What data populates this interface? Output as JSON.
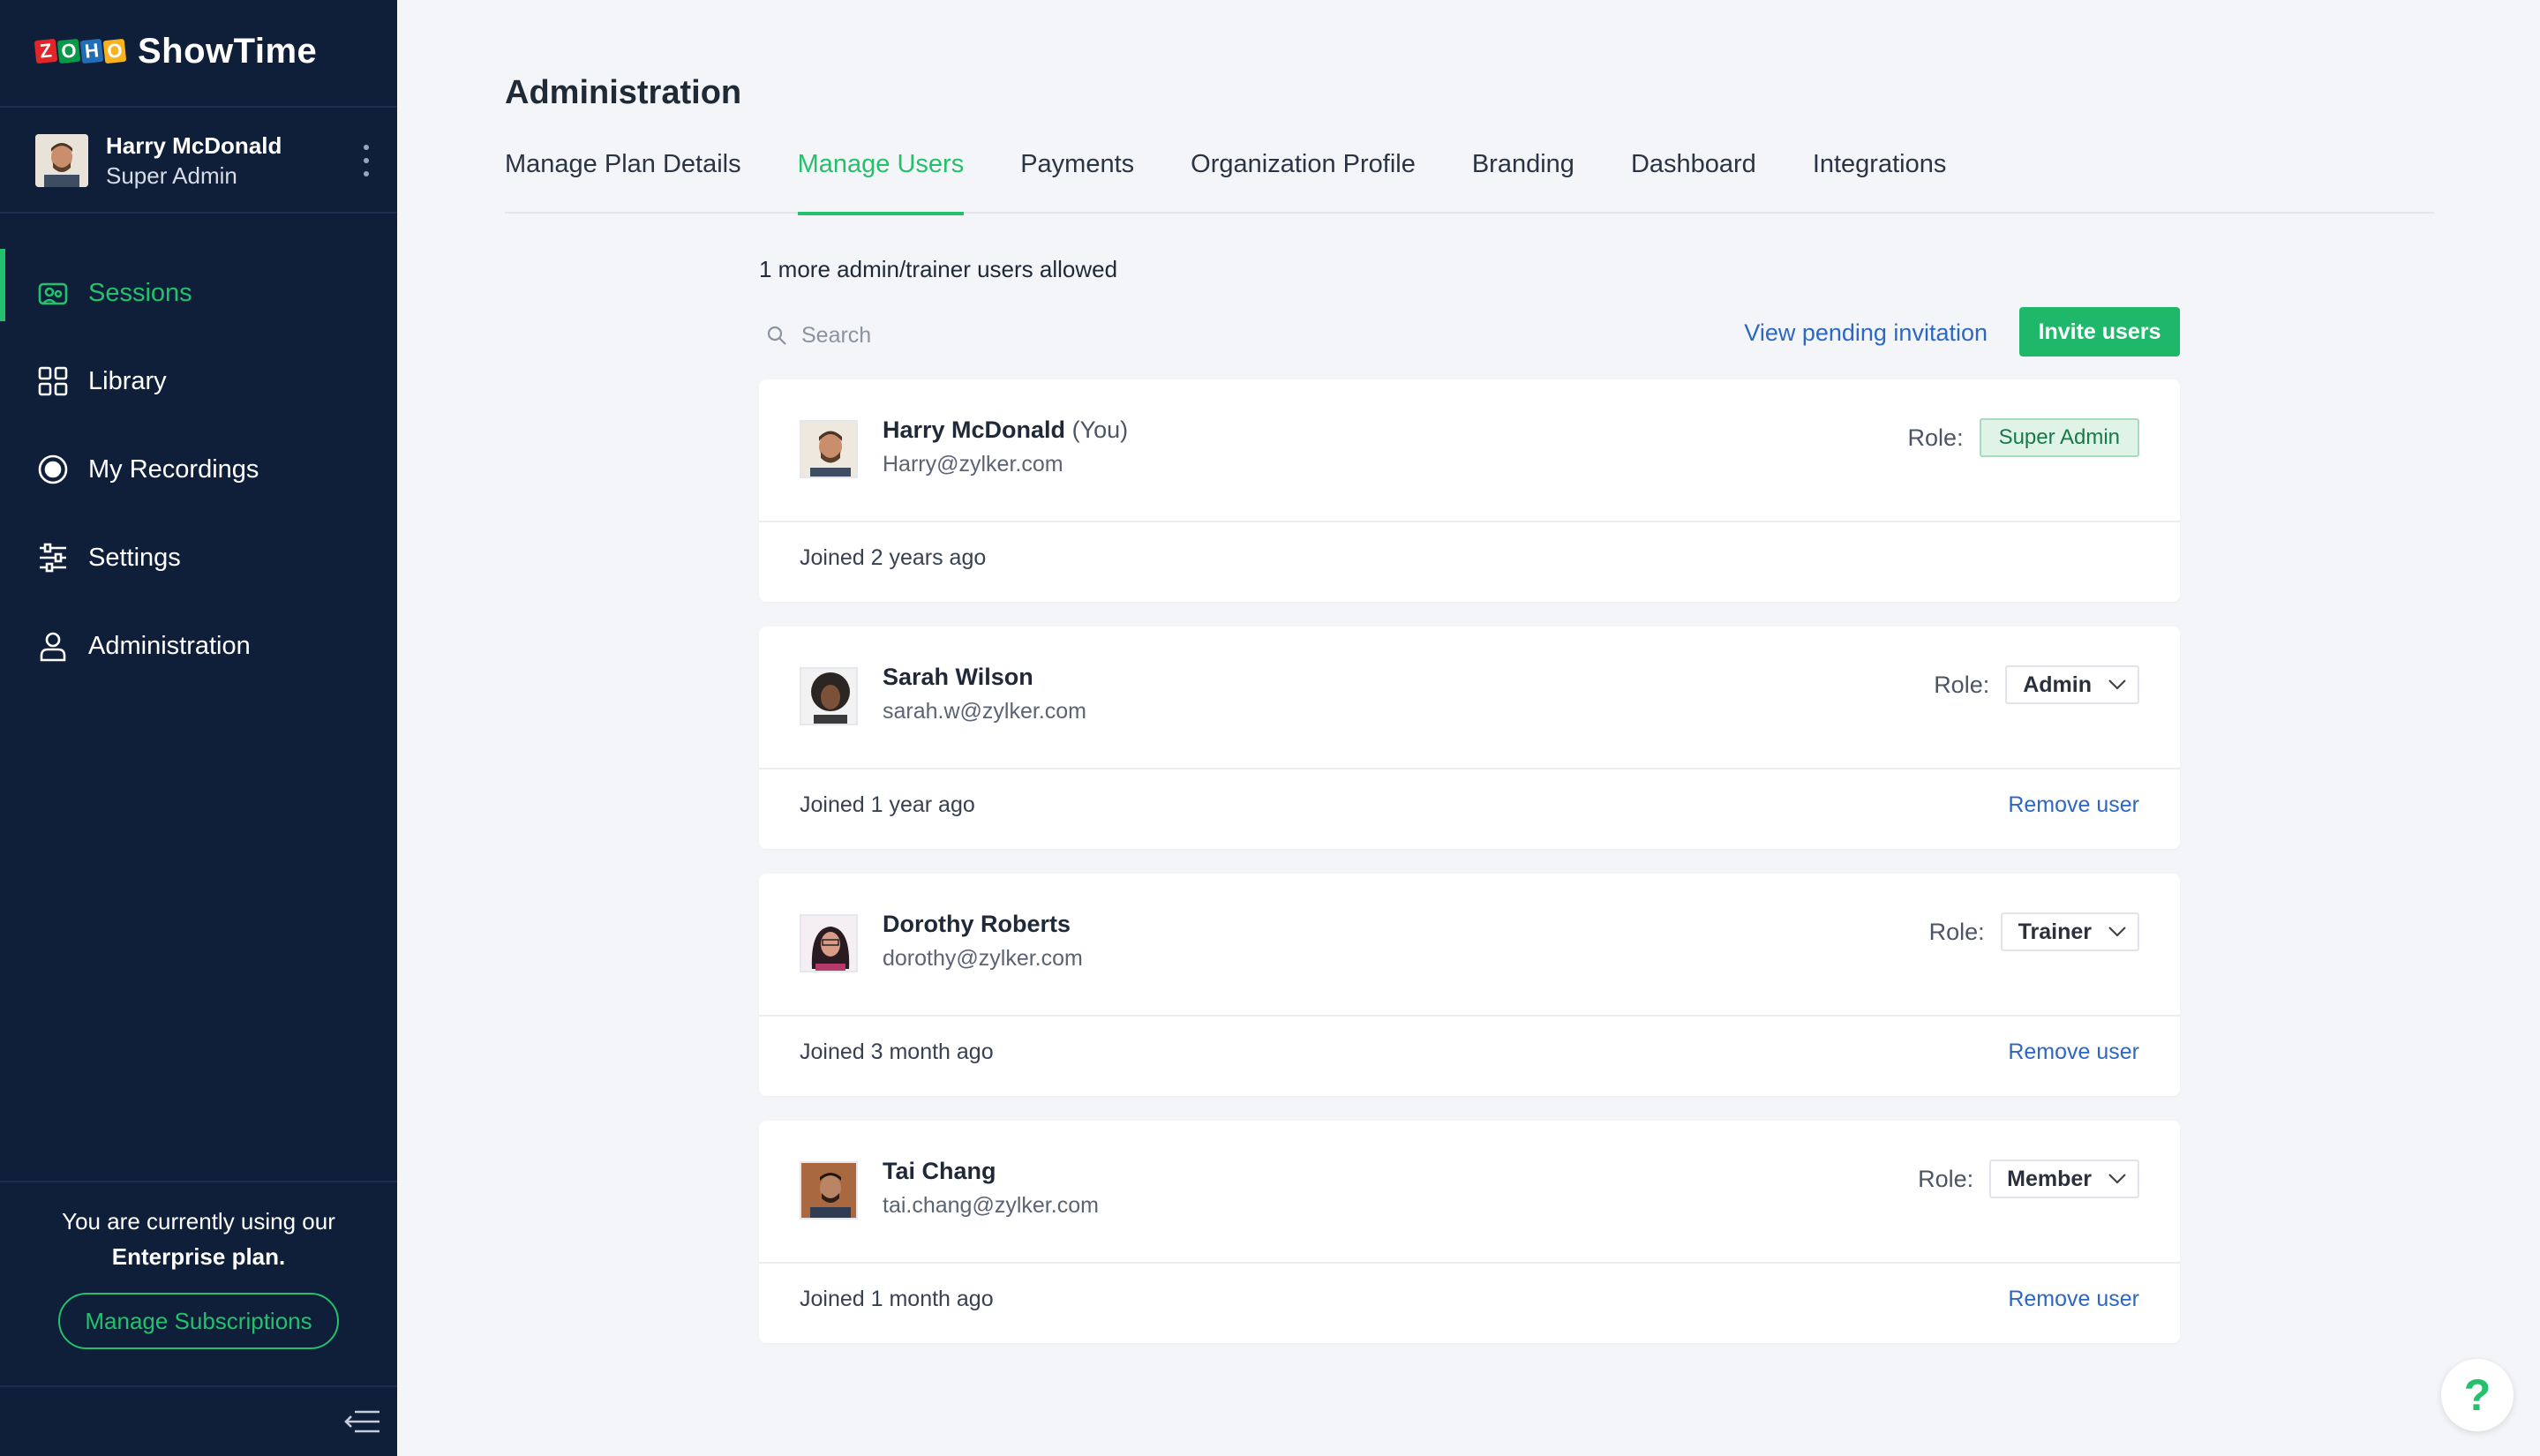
{
  "brand": {
    "logo_letters": [
      "Z",
      "O",
      "H",
      "O"
    ],
    "logo_colors": [
      "#e42527",
      "#089949",
      "#226db4",
      "#f9b21d"
    ],
    "name": "ShowTime"
  },
  "sidebar": {
    "user": {
      "name": "Harry McDonald",
      "role": "Super Admin"
    },
    "nav": [
      {
        "label": "Sessions",
        "icon": "sessions-icon",
        "active": true
      },
      {
        "label": "Library",
        "icon": "library-grid-icon"
      },
      {
        "label": "My Recordings",
        "icon": "record-icon"
      },
      {
        "label": "Settings",
        "icon": "sliders-icon"
      },
      {
        "label": "Administration",
        "icon": "user-icon"
      }
    ],
    "plan_text_prefix": "You are currently using our",
    "plan_text_strong": "Enterprise plan.",
    "manage_subscriptions": "Manage Subscriptions"
  },
  "main": {
    "title": "Administration",
    "tabs": [
      {
        "label": "Manage Plan Details"
      },
      {
        "label": "Manage Users",
        "active": true
      },
      {
        "label": "Payments"
      },
      {
        "label": "Organization Profile"
      },
      {
        "label": "Branding"
      },
      {
        "label": "Dashboard"
      },
      {
        "label": "Integrations"
      }
    ],
    "allowed_text": "1 more admin/trainer users allowed",
    "search_placeholder": "Search",
    "pending_link": "View pending invitation",
    "invite_button": "Invite users",
    "role_label": "Role:",
    "remove_label": "Remove user",
    "users": [
      {
        "name": "Harry McDonald",
        "you": "(You)",
        "email": "Harry@zylker.com",
        "role": "Super Admin",
        "joined": "Joined 2 years ago"
      },
      {
        "name": "Sarah Wilson",
        "email": "sarah.w@zylker.com",
        "role": "Admin",
        "joined": "Joined 1 year ago"
      },
      {
        "name": "Dorothy Roberts",
        "email": "dorothy@zylker.com",
        "role": "Trainer",
        "joined": "Joined 3 month ago"
      },
      {
        "name": "Tai Chang",
        "email": "tai.chang@zylker.com",
        "role": "Member",
        "joined": "Joined 1 month ago"
      }
    ]
  },
  "help": {
    "label": "?"
  },
  "colors": {
    "accent": "#23c16b",
    "sidebar_bg": "#0f1f3a",
    "link": "#2d67c4"
  }
}
